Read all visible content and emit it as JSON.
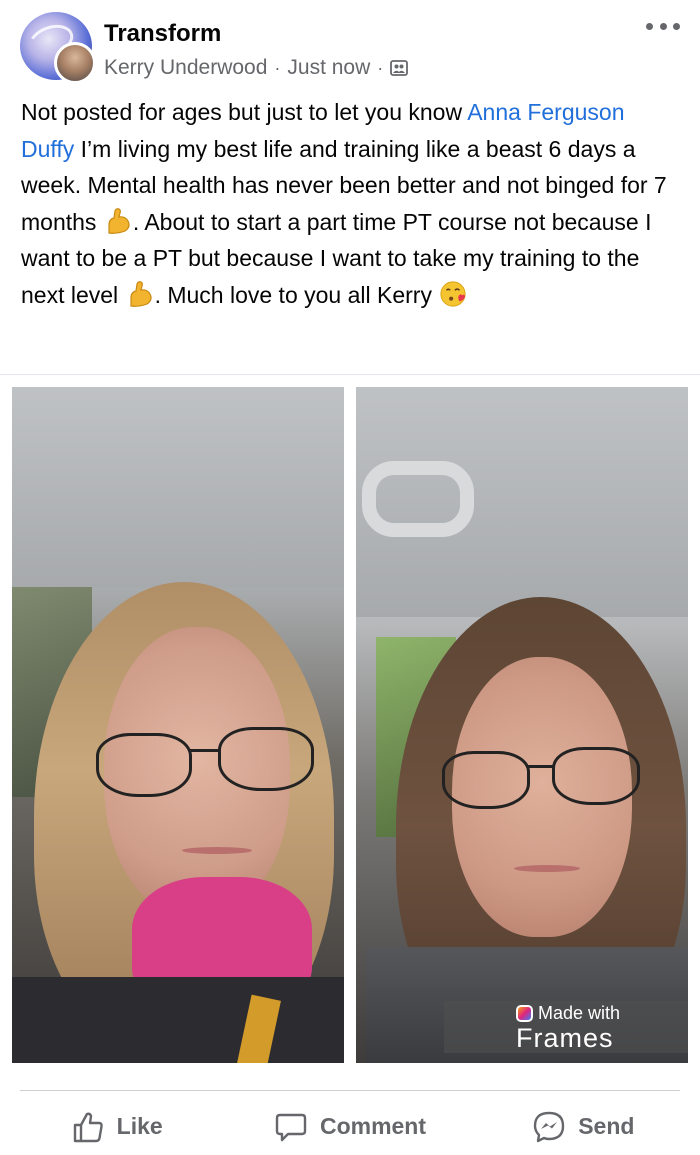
{
  "post": {
    "group_name": "Transform",
    "author": "Kerry Underwood",
    "time": "Just now",
    "separator": "·",
    "privacy": "group-members-icon",
    "text": {
      "before_tag": "Not posted for ages but just to let you know ",
      "tag": "Anna Ferguson Duffy",
      "part2": " I’m living my best life and training like a beast 6 days a week. Mental health has never been better and not binged for 7 months ",
      "part3": ". About to start a part time PT course not because I want to be a PT but because I want to take my training to the next level ",
      "part4": ". Much love to you all Kerry "
    },
    "emojis": [
      "flexed-biceps-icon",
      "flexed-biceps-icon",
      "face-blowing-kiss-icon"
    ]
  },
  "photos": {
    "left": {
      "name": "before-selfie"
    },
    "right": {
      "name": "after-selfie"
    },
    "watermark": {
      "made_with": "Made with",
      "brand": "Frames"
    }
  },
  "actions": {
    "like": "Like",
    "comment": "Comment",
    "send": "Send"
  },
  "colors": {
    "link": "#216fdb",
    "muted": "#65676b",
    "text": "#050505",
    "scarf": "#d83f87"
  }
}
